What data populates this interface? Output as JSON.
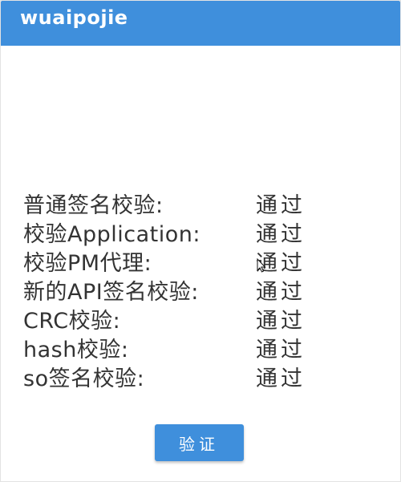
{
  "app": {
    "title": "wuaipojie"
  },
  "results": [
    {
      "label": "普通签名校验:",
      "status": "通过"
    },
    {
      "label": "校验Application:",
      "status": "通过"
    },
    {
      "label": "校验PM代理:",
      "status": "通过"
    },
    {
      "label": "新的API签名校验:",
      "status": "通过"
    },
    {
      "label": "CRC校验:",
      "status": "通过"
    },
    {
      "label": "hash校验:",
      "status": "通过"
    },
    {
      "label": "so签名校验:",
      "status": "通过"
    }
  ],
  "actions": {
    "verify_label": "验证"
  },
  "colors": {
    "accent": "#3f8fdc",
    "text": "#333333",
    "background": "#ffffff"
  },
  "icons": {
    "cursor": "mouse-pointer-icon"
  }
}
